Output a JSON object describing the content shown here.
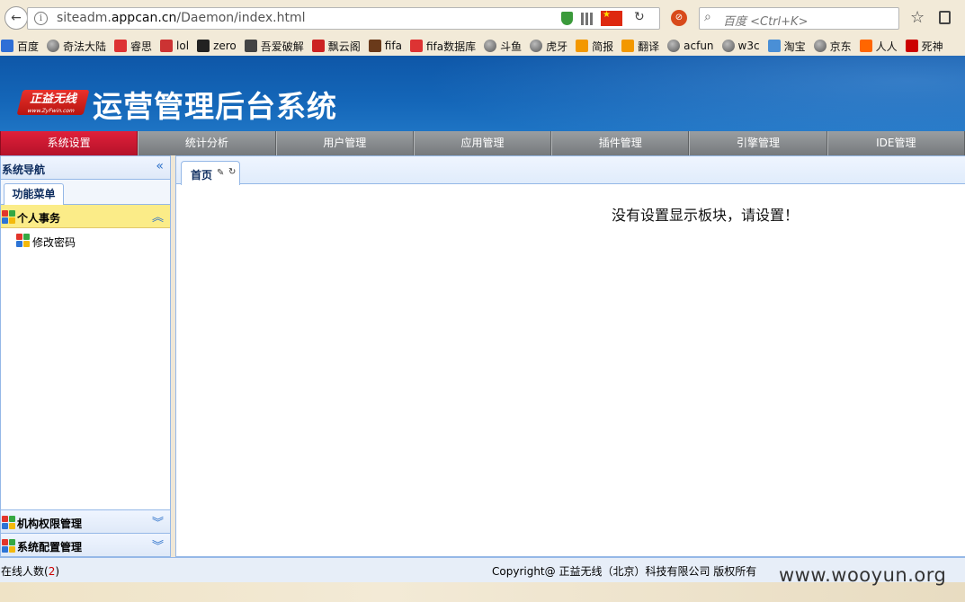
{
  "browser": {
    "url_prefix": "siteadm.",
    "url_domain": "appcan.cn",
    "url_path": "/Daemon/index.html",
    "search_placeholder": "百度 <Ctrl+K>",
    "bookmarks": [
      "百度",
      "奇法大陆",
      "睿思",
      "lol",
      "zero",
      "吾爱破解",
      "飘云阁",
      "fifa",
      "fifa数据库",
      "斗鱼",
      "虎牙",
      "简报",
      "翻译",
      "acfun",
      "w3c",
      "淘宝",
      "京东",
      "人人",
      "死神"
    ]
  },
  "header": {
    "logo_text": "正益无线",
    "logo_sub": "www.ZyFwin.com",
    "title": "运营管理后台系统"
  },
  "nav": {
    "items": [
      "系统设置",
      "统计分析",
      "用户管理",
      "应用管理",
      "插件管理",
      "引擎管理",
      "IDE管理"
    ],
    "active_index": 0
  },
  "sidebar": {
    "title": "系统导航",
    "tab": "功能菜单",
    "sections": [
      {
        "label": "个人事务",
        "items": [
          "修改密码"
        ]
      },
      {
        "label": "机构权限管理"
      },
      {
        "label": "系统配置管理"
      }
    ]
  },
  "content": {
    "tab_label": "首页",
    "empty_message": "没有设置显示板块，请设置！"
  },
  "footer": {
    "online_label": "在线人数(",
    "online_count": "2",
    "online_suffix": ")",
    "copyright": "Copyright@ 正益无线（北京）科技有限公司 版权所有"
  },
  "watermark": "www.wooyun.org",
  "colors": {
    "header_blue": "#0e57a8",
    "active_nav_red": "#d01a32",
    "panel_border": "#95b8e7",
    "open_section_yellow": "#fbec88"
  }
}
